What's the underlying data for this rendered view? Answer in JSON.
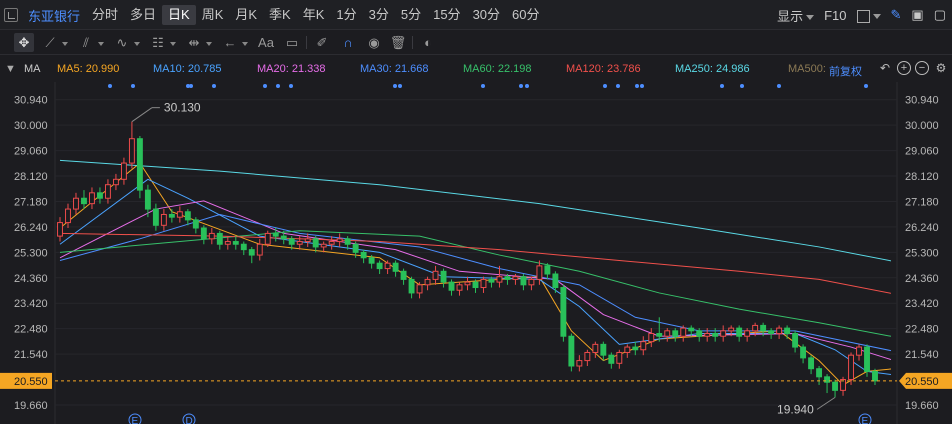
{
  "header": {
    "stock_name": "东亚银行",
    "periods": [
      {
        "label": "分时",
        "active": false
      },
      {
        "label": "多日",
        "active": false
      },
      {
        "label": "日K",
        "active": true
      },
      {
        "label": "周K",
        "active": false
      },
      {
        "label": "月K",
        "active": false
      },
      {
        "label": "季K",
        "active": false
      },
      {
        "label": "年K",
        "active": false
      },
      {
        "label": "1分",
        "active": false
      },
      {
        "label": "3分",
        "active": false
      },
      {
        "label": "5分",
        "active": false
      },
      {
        "label": "15分",
        "active": false
      },
      {
        "label": "30分",
        "active": false
      },
      {
        "label": "60分",
        "active": false
      }
    ],
    "display_label": "显示",
    "f10_label": "F10"
  },
  "toolbar": {
    "text_tool_label": "Aa",
    "icons": [
      "crosshair-icon",
      "line-icon",
      "channel-icon",
      "wave-icon",
      "fibonacci-icon",
      "range-icon",
      "arrow-left-icon",
      "text-icon",
      "comment-icon",
      "eraser-icon",
      "magnet-icon",
      "eye-icon",
      "trash-icon",
      "toggle-icon"
    ]
  },
  "ma_bar": {
    "prefix": "MA",
    "items": [
      {
        "label": "MA5: 20.990",
        "color": "#f5a623"
      },
      {
        "label": "MA10: 20.785",
        "color": "#4aa3ff"
      },
      {
        "label": "MA20: 21.338",
        "color": "#e66de8"
      },
      {
        "label": "MA30: 21.668",
        "color": "#4d8eff"
      },
      {
        "label": "MA60: 22.198",
        "color": "#37c06a"
      },
      {
        "label": "MA120: 23.786",
        "color": "#f0504b"
      },
      {
        "label": "MA250: 24.986",
        "color": "#5ad9e6"
      },
      {
        "label": "MA500:",
        "color": "#8c7a55"
      }
    ],
    "adjust_label": "前复权"
  },
  "chart_data": {
    "type": "candlestick",
    "y_ticks": [
      "30.940",
      "30.000",
      "29.060",
      "28.120",
      "27.180",
      "26.240",
      "25.300",
      "24.360",
      "23.420",
      "22.480",
      "21.540",
      "20.550",
      "19.660"
    ],
    "ylim": [
      19.4,
      31.3
    ],
    "current_price": "20.550",
    "high_annotation": "30.130",
    "low_annotation": "19.940",
    "event_markers": [
      "E",
      "D",
      "E"
    ],
    "up_color": "#ec4b4b",
    "down_color": "#29c05a",
    "candles": [
      [
        25.9,
        26.4,
        25.7,
        26.6
      ],
      [
        26.4,
        26.9,
        26.2,
        27.1
      ],
      [
        26.9,
        27.3,
        26.7,
        27.5
      ],
      [
        27.3,
        27.1,
        26.9,
        27.6
      ],
      [
        27.1,
        27.5,
        26.9,
        27.7
      ],
      [
        27.5,
        27.3,
        27.1,
        27.7
      ],
      [
        27.3,
        27.8,
        27.1,
        28.0
      ],
      [
        27.8,
        28.0,
        27.6,
        28.2
      ],
      [
        28.0,
        28.6,
        27.8,
        28.8
      ],
      [
        28.6,
        29.5,
        28.4,
        30.13
      ],
      [
        29.5,
        27.6,
        27.3,
        29.6
      ],
      [
        27.6,
        26.9,
        26.6,
        27.8
      ],
      [
        26.9,
        26.3,
        26.1,
        27.1
      ],
      [
        26.3,
        26.7,
        26.1,
        26.9
      ],
      [
        26.7,
        26.6,
        26.4,
        26.9
      ],
      [
        26.6,
        26.8,
        26.4,
        27.0
      ],
      [
        26.8,
        26.5,
        26.3,
        26.9
      ],
      [
        26.5,
        26.2,
        26.0,
        26.6
      ],
      [
        26.2,
        25.8,
        25.6,
        26.3
      ],
      [
        25.8,
        26.0,
        25.6,
        26.2
      ],
      [
        26.0,
        25.6,
        25.4,
        26.1
      ],
      [
        25.6,
        25.7,
        25.4,
        25.9
      ],
      [
        25.7,
        25.6,
        25.4,
        25.9
      ],
      [
        25.6,
        25.4,
        25.2,
        25.7
      ],
      [
        25.4,
        25.2,
        24.9,
        25.5
      ],
      [
        25.2,
        25.6,
        25.0,
        25.8
      ],
      [
        25.6,
        26.0,
        25.5,
        26.1
      ],
      [
        26.0,
        25.9,
        25.7,
        26.2
      ],
      [
        25.9,
        25.8,
        25.6,
        26.1
      ],
      [
        25.8,
        25.6,
        25.4,
        25.9
      ],
      [
        25.6,
        25.7,
        25.4,
        25.9
      ],
      [
        25.7,
        25.8,
        25.5,
        26.0
      ],
      [
        25.8,
        25.5,
        25.3,
        25.9
      ],
      [
        25.5,
        25.6,
        25.3,
        25.7
      ],
      [
        25.6,
        25.7,
        25.4,
        25.9
      ],
      [
        25.7,
        25.8,
        25.5,
        26.0
      ],
      [
        25.8,
        25.6,
        25.4,
        25.9
      ],
      [
        25.6,
        25.3,
        25.1,
        25.7
      ],
      [
        25.3,
        25.1,
        24.9,
        25.4
      ],
      [
        25.1,
        24.9,
        24.7,
        25.2
      ],
      [
        24.9,
        24.7,
        24.5,
        25.0
      ],
      [
        24.7,
        24.9,
        24.5,
        25.0
      ],
      [
        24.9,
        24.6,
        24.4,
        25.0
      ],
      [
        24.6,
        24.3,
        24.1,
        24.7
      ],
      [
        24.3,
        23.8,
        23.6,
        24.4
      ],
      [
        23.8,
        24.1,
        23.6,
        24.2
      ],
      [
        24.1,
        24.3,
        23.9,
        24.4
      ],
      [
        24.3,
        24.6,
        24.1,
        24.8
      ],
      [
        24.6,
        24.2,
        24.0,
        24.7
      ],
      [
        24.2,
        23.9,
        23.7,
        24.3
      ],
      [
        23.9,
        24.1,
        23.7,
        24.2
      ],
      [
        24.1,
        24.2,
        23.9,
        24.4
      ],
      [
        24.2,
        24.0,
        23.8,
        24.3
      ],
      [
        24.0,
        24.3,
        23.8,
        24.4
      ],
      [
        24.3,
        24.2,
        24.0,
        24.4
      ],
      [
        24.2,
        24.4,
        24.0,
        24.8
      ],
      [
        24.4,
        24.3,
        24.1,
        24.5
      ],
      [
        24.3,
        24.4,
        24.1,
        24.5
      ],
      [
        24.4,
        24.1,
        23.9,
        24.5
      ],
      [
        24.1,
        24.3,
        23.9,
        24.4
      ],
      [
        24.3,
        24.8,
        24.1,
        25.0
      ],
      [
        24.8,
        24.5,
        24.3,
        24.9
      ],
      [
        24.5,
        24.0,
        23.8,
        24.6
      ],
      [
        24.0,
        22.2,
        22.0,
        24.1
      ],
      [
        22.2,
        21.1,
        20.9,
        22.3
      ],
      [
        21.1,
        21.3,
        20.9,
        21.5
      ],
      [
        21.3,
        21.6,
        21.1,
        21.7
      ],
      [
        21.6,
        21.9,
        21.4,
        22.0
      ],
      [
        21.9,
        21.5,
        21.3,
        22.0
      ],
      [
        21.5,
        21.2,
        21.0,
        21.6
      ],
      [
        21.2,
        21.6,
        21.0,
        21.7
      ],
      [
        21.6,
        21.8,
        21.4,
        21.9
      ],
      [
        21.8,
        21.7,
        21.5,
        22.0
      ],
      [
        21.7,
        22.0,
        21.5,
        22.2
      ],
      [
        22.0,
        22.3,
        21.8,
        22.5
      ],
      [
        22.3,
        22.2,
        22.0,
        22.9
      ],
      [
        22.2,
        22.4,
        22.0,
        22.5
      ],
      [
        22.4,
        22.2,
        22.0,
        22.5
      ],
      [
        22.2,
        22.5,
        22.0,
        22.6
      ],
      [
        22.5,
        22.4,
        22.2,
        22.6
      ],
      [
        22.4,
        22.2,
        22.0,
        22.5
      ],
      [
        22.2,
        22.3,
        22.0,
        22.5
      ],
      [
        22.3,
        22.2,
        22.0,
        22.5
      ],
      [
        22.2,
        22.4,
        22.0,
        22.6
      ],
      [
        22.4,
        22.5,
        22.2,
        22.6
      ],
      [
        22.5,
        22.2,
        22.0,
        22.6
      ],
      [
        22.2,
        22.4,
        22.0,
        22.5
      ],
      [
        22.4,
        22.6,
        22.2,
        22.7
      ],
      [
        22.6,
        22.4,
        22.2,
        22.7
      ],
      [
        22.4,
        22.3,
        22.1,
        22.5
      ],
      [
        22.3,
        22.5,
        22.1,
        22.6
      ],
      [
        22.5,
        22.3,
        22.1,
        22.6
      ],
      [
        22.3,
        21.8,
        21.6,
        22.4
      ],
      [
        21.8,
        21.4,
        21.2,
        21.9
      ],
      [
        21.4,
        21.0,
        20.8,
        21.5
      ],
      [
        21.0,
        20.7,
        20.4,
        21.1
      ],
      [
        20.7,
        20.5,
        20.1,
        20.8
      ],
      [
        20.5,
        20.2,
        19.94,
        20.6
      ],
      [
        20.2,
        20.6,
        20.0,
        20.7
      ],
      [
        20.6,
        21.5,
        20.4,
        21.6
      ],
      [
        21.5,
        21.8,
        21.3,
        21.9
      ],
      [
        21.8,
        20.9,
        20.7,
        21.9
      ],
      [
        20.9,
        20.55,
        20.4,
        21.0
      ]
    ],
    "ma_series": [
      {
        "name": "MA5",
        "color": "#f5a623",
        "values": [
          [
            0,
            26.2
          ],
          [
            10,
            28.6
          ],
          [
            14,
            26.8
          ],
          [
            25,
            25.6
          ],
          [
            40,
            25.1
          ],
          [
            45,
            24.1
          ],
          [
            60,
            24.4
          ],
          [
            64,
            22.4
          ],
          [
            68,
            21.3
          ],
          [
            75,
            22.1
          ],
          [
            90,
            22.4
          ],
          [
            95,
            21.3
          ],
          [
            98,
            20.4
          ],
          [
            101,
            20.9
          ],
          [
            104,
            20.99
          ]
        ]
      },
      {
        "name": "MA10",
        "color": "#4aa3ff",
        "values": [
          [
            0,
            25.6
          ],
          [
            11,
            28.0
          ],
          [
            16,
            27.3
          ],
          [
            25,
            25.9
          ],
          [
            40,
            25.3
          ],
          [
            48,
            24.4
          ],
          [
            60,
            24.3
          ],
          [
            65,
            23.3
          ],
          [
            70,
            21.9
          ],
          [
            80,
            22.3
          ],
          [
            92,
            22.3
          ],
          [
            97,
            21.7
          ],
          [
            101,
            20.9
          ],
          [
            104,
            20.785
          ]
        ]
      },
      {
        "name": "MA20",
        "color": "#e66de8",
        "values": [
          [
            0,
            25.1
          ],
          [
            12,
            26.9
          ],
          [
            18,
            27.2
          ],
          [
            28,
            26.0
          ],
          [
            42,
            25.4
          ],
          [
            50,
            24.6
          ],
          [
            62,
            24.3
          ],
          [
            68,
            23.0
          ],
          [
            75,
            22.2
          ],
          [
            92,
            22.3
          ],
          [
            99,
            21.8
          ],
          [
            104,
            21.338
          ]
        ]
      },
      {
        "name": "MA30",
        "color": "#4d8eff",
        "values": [
          [
            0,
            25.0
          ],
          [
            10,
            25.8
          ],
          [
            20,
            26.7
          ],
          [
            30,
            26.0
          ],
          [
            45,
            25.5
          ],
          [
            55,
            24.7
          ],
          [
            65,
            24.1
          ],
          [
            72,
            22.9
          ],
          [
            80,
            22.4
          ],
          [
            92,
            22.4
          ],
          [
            104,
            21.668
          ]
        ]
      },
      {
        "name": "MA60",
        "color": "#37c06a",
        "values": [
          [
            0,
            25.3
          ],
          [
            15,
            25.7
          ],
          [
            30,
            26.1
          ],
          [
            45,
            25.9
          ],
          [
            55,
            25.2
          ],
          [
            65,
            24.6
          ],
          [
            75,
            23.8
          ],
          [
            85,
            23.2
          ],
          [
            95,
            22.7
          ],
          [
            104,
            22.198
          ]
        ]
      },
      {
        "name": "MA120",
        "color": "#f0504b",
        "values": [
          [
            0,
            26.0
          ],
          [
            20,
            25.9
          ],
          [
            40,
            25.7
          ],
          [
            55,
            25.4
          ],
          [
            70,
            25.0
          ],
          [
            85,
            24.6
          ],
          [
            95,
            24.3
          ],
          [
            104,
            23.786
          ]
        ]
      },
      {
        "name": "MA250",
        "color": "#5ad9e6",
        "values": [
          [
            0,
            28.7
          ],
          [
            20,
            28.3
          ],
          [
            40,
            27.8
          ],
          [
            60,
            27.1
          ],
          [
            80,
            26.2
          ],
          [
            95,
            25.5
          ],
          [
            104,
            24.986
          ]
        ]
      }
    ]
  }
}
